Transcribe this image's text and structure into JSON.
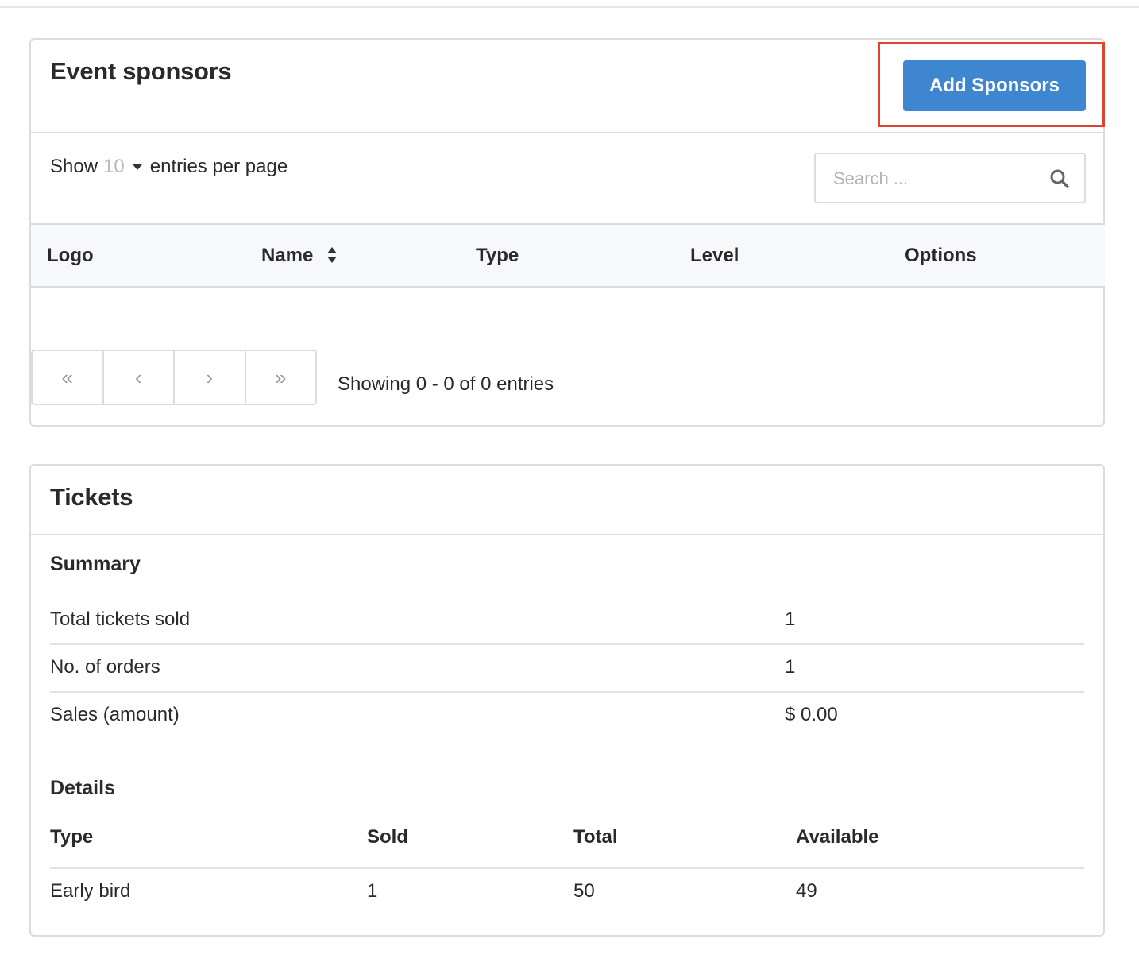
{
  "sponsors": {
    "title": "Event sponsors",
    "add_button": "Add Sponsors",
    "show_label": "Show",
    "entries_value": "10",
    "entries_suffix": "entries per page",
    "search_placeholder": "Search ...",
    "columns": [
      "Logo",
      "Name",
      "Type",
      "Level",
      "Options"
    ],
    "pager": {
      "first": "«",
      "prev": "‹",
      "next": "›",
      "last": "»"
    },
    "showing_text": "Showing 0 - 0 of 0 entries"
  },
  "tickets": {
    "title": "Tickets",
    "summary_title": "Summary",
    "summary": [
      {
        "label": "Total tickets sold",
        "value": "1"
      },
      {
        "label": "No. of orders",
        "value": "1"
      },
      {
        "label": "Sales (amount)",
        "value": "$ 0.00"
      }
    ],
    "details_title": "Details",
    "details_columns": [
      "Type",
      "Sold",
      "Total",
      "Available"
    ],
    "details_rows": [
      [
        "Early bird",
        "1",
        "50",
        "49"
      ]
    ]
  },
  "colors": {
    "primary_button": "#3f86d1",
    "highlight_outline": "#e1412f"
  },
  "icons": [
    "search-icon",
    "dropdown-caret-icon",
    "sort-icon",
    "first-page-icon",
    "prev-page-icon",
    "next-page-icon",
    "last-page-icon"
  ]
}
